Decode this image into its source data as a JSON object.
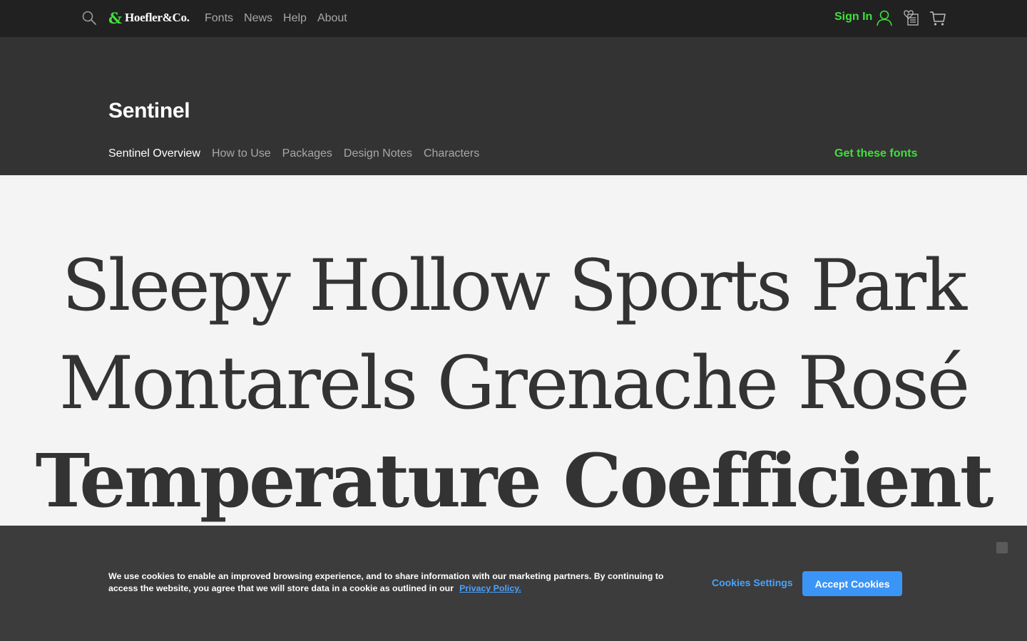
{
  "topbar": {
    "brand_symbol": "&",
    "brand_name": "Hoefler&Co.",
    "nav": [
      "Fonts",
      "News",
      "Help",
      "About"
    ],
    "sign_in": "Sign In",
    "icons": [
      "search-icon",
      "user-icon",
      "favorites-icon",
      "cart-icon"
    ],
    "accent_color": "#3fe03a"
  },
  "family": {
    "title": "Sentinel",
    "tabs": [
      "Sentinel Overview",
      "How to Use",
      "Packages",
      "Design Notes",
      "Characters"
    ],
    "active_tab": "Sentinel Overview",
    "cta": "Get these fonts"
  },
  "specimen": {
    "lines": [
      "Sleepy Hollow Sports Park",
      "Montarels Grenache Rosé",
      "Temperature Coefficient"
    ]
  },
  "cookie_banner": {
    "text": "We use cookies to enable an improved browsing experience, and to share information with our marketing partners. By continuing to access the website, you agree that we will store data in a cookie as outlined in our",
    "privacy_link": "Privacy Policy.",
    "settings_label": "Cookies Settings",
    "accept_label": "Accept Cookies",
    "accept_color": "#3b95f7"
  }
}
